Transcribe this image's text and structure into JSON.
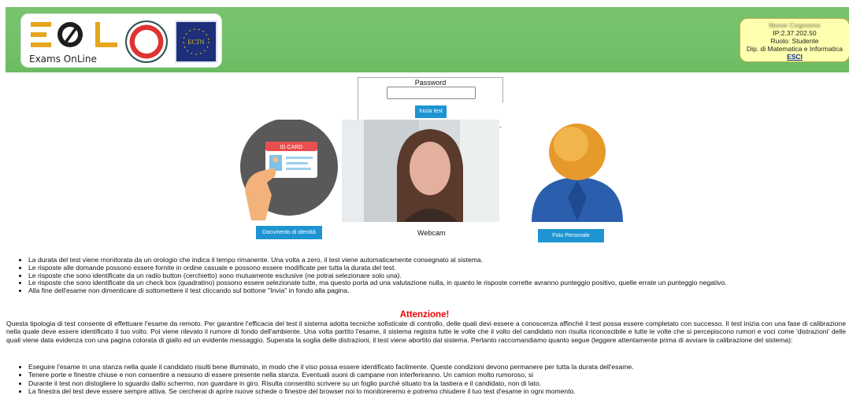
{
  "header": {
    "brand_text": "Exams OnLine",
    "seal2_text": "ECTN",
    "user": {
      "name": "Nome Cognome",
      "ip": "IP:2.37.202.50",
      "role": "Ruolo: Studente",
      "department": "Dip. di Matematica e Informatica",
      "logout": "ESCI"
    },
    "colors": {
      "bar": "#73c06a",
      "userbox": "#ffffb0"
    }
  },
  "password": {
    "label": "Password",
    "value": "",
    "button": "Inizia test"
  },
  "capture": {
    "id_button": "Documento di identità",
    "id_card_title": "ID CARD",
    "webcam_label": "Webcam",
    "photo_button": "Foto Personale"
  },
  "rules": [
    "La durata del test viene monitorata da un orologio che indica il tempo rimanente. Una volta a zero, il test viene automaticamente consegnato al sistema.",
    "Le risposte alle domande possono essere fornite in ordine casuale e possono essere modificate per tutta la durata del test.",
    "Le risposte che sono identificate da un radio button (cerchietto) sono mutuamente esclusive (ne potrai selezionare solo una).",
    "Le risposte che sono identificate da un check box (quadratino) possono essere selezionate tutte, ma questo porta ad una valutazione nulla, in quanto le risposte corrette avranno punteggio positivo, quelle errate un punteggio negativo.",
    "Alla fine dell'esame non dimenticare di sottomettere il test cliccando sul bottone \"Invia\" in fondo alla pagina."
  ],
  "attention": {
    "title": "Attenzione!",
    "paragraph": "Questa tipologia di test consente di effettuare l'esame da remoto. Per garantire l'efficacia del test il sistema adotta tecniche sofisticate di controllo, delle quali devi essere a conoscenza affinché il test possa essere completato con successo. Il test inizia con una fase di calibrazione nella quale deve essere identificato il tuo volto. Poi viene rilevato il rumore di fondo dell'ambiente. Una volta partito l'esame, il sistema registra tutte le volte che il volto del candidato non risulta riconoscibile e tutte le volte che si percepiscono rumori e voci come 'distrazioni' delle quali viene data evidenza con una pagina colorata di giallo ed un evidente messaggio. Superata la soglia delle distrazioni, il test viene abortito dal sistema. Pertanto raccomandiamo quanto segue (leggere attentamente prima di avviare la calibrazione del sistema):"
  },
  "advice": [
    "Eseguire l'esame in una stanza nella quale il candidato risulti bene illuminato, in modo che il viso possa essere identificato facilmente. Queste condizioni devono permanere per tutta la durata dell'esame.",
    "Tenere porte e finestre chiuse e non consentire a nessuno di essere presente nella stanza. Eventuali suoni di campane non interferiranno. Un camion molto rumoroso, si",
    "Durante il test non distogliere lo sguardo dallo schermo, non guardare in giro. Risulta consentito scrivere su un foglio purché situato tra la tastiera e il candidato, non di lato.",
    "La finestra del test deve essere sempre attiva. Se cercherai di aprire nuove schede o finestre del browser noi lo monitoreremo e potremo chiudere il tuo test d'esame in ogni momento."
  ]
}
